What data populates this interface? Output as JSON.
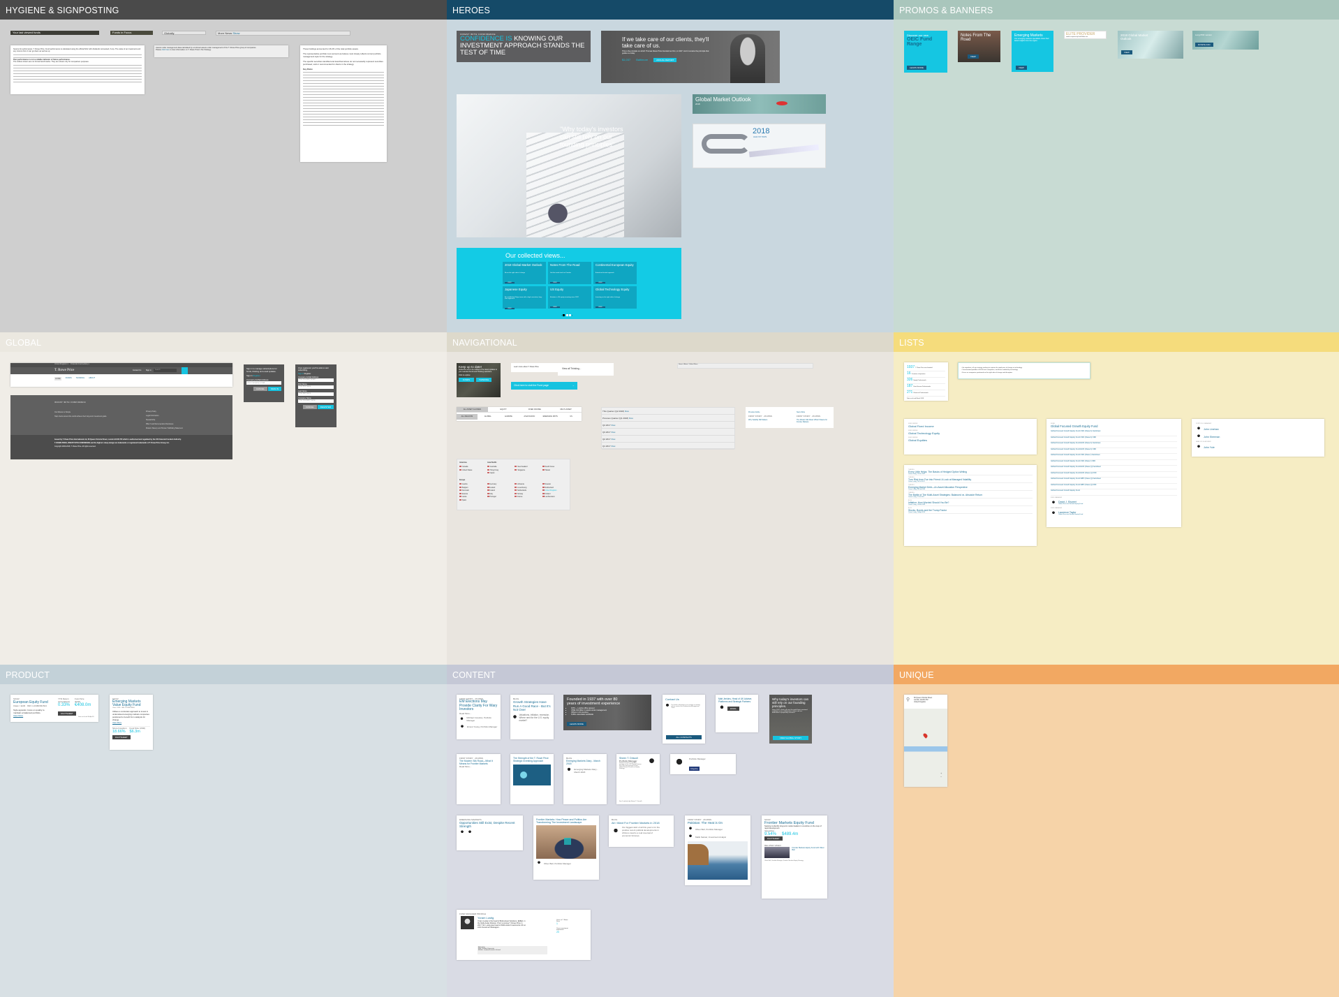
{
  "sections": {
    "hygiene": "HYGIENE & SIGNPOSTING",
    "heroes": "HEROES",
    "promos": "PROMOS & BANNERS",
    "global": "GLOBAL",
    "navigational": "NAVIGATIONAL",
    "lists": "LISTS",
    "product": "PRODUCT",
    "content": "CONTENT",
    "unique": "UNIQUE"
  },
  "colors": {
    "accent": "#16c3e0",
    "link": "#1a6e95",
    "navy": "#1b5a7e"
  },
  "hygiene": {
    "bars": [
      "Your last viewed funds",
      "Funds in Focus",
      "Globally",
      "More News"
    ],
    "show": "Show",
    "doc1": {
      "p1": "Source for performance: T. Rowe Price. Fund performance is calculated using the official NAV with dividends reinvested, if any. The value of an investment and any income from it can go down as well as up.",
      "bold": "Past performance is not a reliable indicator of future performance.",
      "p2": "The indices shown are not formal benchmarks. They are shown only for comparison purposes."
    },
    "doc2": {
      "p1": "Assets under management data calculated by combined assets under management of the T. Rowe Price group of companies.",
      "p2a": "Please ",
      "link": "click here",
      "p2b": " to view information on T. Rowe Price's Tax Strategy."
    },
    "doc3": {
      "p1": "These holdings accounted for 26.2% of the total portfolio assets.",
      "p2": "The representative portfolio is an account we believe most closely reflects current portfolio management style for the strategy.",
      "p3": "The specific securities identified and described above do not necessarily represent securities purchased, sold or recommended for clients in the strategy.",
      "risk": "Key Risks:"
    }
  },
  "heroes": {
    "confidence": {
      "eyebrow": "INVEST WITH CONFIDENCE",
      "hl": "CONFIDENCE IS",
      "rest": " KNOWING OUR INVESTMENT APPROACH STANDS THE TEST OF TIME"
    },
    "quote": {
      "text": "If we take care of our clients, they'll take care of us.",
      "sub": "This is the principle on which Thomas Rowe Price founded our firm, in 1937. And it remains the principle that guides us today.",
      "s1": "$1,037",
      "s2": "Baltimore",
      "button": "ANNUAL REPORT"
    },
    "stairs": "\"Why today's investors can still rely on our founding principles\"",
    "gmo": {
      "title": "Global Market Outlook",
      "year": "2018"
    },
    "trip": {
      "year": "2018",
      "sub": "ANALYST TRIPS"
    },
    "collected": {
      "title": "Our collected views...",
      "view": "VIEW",
      "items": [
        {
          "t": "2018 Global Market Outlook",
          "d": "Be on the right side of change"
        },
        {
          "t": "Notes From The Road",
          "d": "Get the inside track on Frontier"
        },
        {
          "t": "Continental European Equity",
          "d": "A tried and tested approach"
        },
        {
          "t": "Japanese Equity",
          "d": "An established Tokyo team with a high conviction, long-term approach"
        },
        {
          "t": "US Equity",
          "d": "A leader in US equity investing since 1937"
        },
        {
          "t": "Global Technology Equity",
          "d": "Investing on the right side of change"
        }
      ]
    }
  },
  "promos": {
    "oeic": {
      "pre": "Discover our new",
      "title": "OEIC Fund Range",
      "button": "LEARN MORE"
    },
    "notes": {
      "title": "Notes From The Road",
      "button": "VIEW"
    },
    "em": {
      "title": "Emerging Markets",
      "desc": "Our emerging markets specialists share their latest insights from the region.",
      "button": "VIEW"
    },
    "elite": {
      "title": "ELITE PROVIDER",
      "sub": "rated for expertise by FundCalibre.com"
    },
    "gmo": {
      "title": "2018 Global Market Outlook",
      "button": "VIEW"
    },
    "pdf": {
      "title": "Long PDF version",
      "button": "DOWNLOAD"
    }
  },
  "global": {
    "topbar": {
      "country": "United Kingdom",
      "role": "Financial Intermediary",
      "logo": "T. Rowe Price",
      "contact": "Contact Us",
      "signin": "Sign in",
      "search": "Search"
    },
    "nav": [
      "HOME",
      "FUNDS",
      "THINKING",
      "ABOUT"
    ],
    "footer": {
      "tag": "INVEST WITH CONFIDENCE",
      "mission_h": "Our Mission is Simple",
      "mission": "Help clients around the world achieve their long-term investment goals.",
      "links": [
        "Privacy Policy",
        "Legal Information",
        "Stewardship",
        "Pillar 3 and Remuneration Disclosure",
        "Modern Slavery and Human Trafficking Statement"
      ],
      "issued": "Issued by T. Rowe Price International Ltd, 60 Queen Victoria Street, London EC4N 4TZ which is authorised and regulated by the UK Financial Conduct Authority.",
      "tm": "T. ROWE PRICE, INVEST WITH CONFIDENCE and the bighorn sheep design are trademarks or registered trademarks of T. Rowe Price Group, Inc.",
      "copy": "Copyright 2000-2018, T. Rowe Price. All rights reserved."
    },
    "signin": {
      "text": "Sign in to manage subscriptions for funds, thinking and email updates.",
      "tabs": [
        "Sign in",
        "Register"
      ],
      "label": "Company E-Mail Address",
      "ph": "Your company email",
      "cancel": "CANCEL",
      "submit": "SIGN IN"
    },
    "register": {
      "text": "Once registered, you'll be able to start subscribing.",
      "tabs": [
        "Sign in",
        "Register"
      ],
      "fields": [
        {
          "l": "Company E-Mail Address",
          "p": "Your company email"
        },
        {
          "l": "First Name",
          "p": "Your first name"
        },
        {
          "l": "Last Name",
          "p": "Your last name"
        },
        {
          "l": "Company Name",
          "p": "Your company name"
        }
      ],
      "cancel": "CANCEL",
      "submit": "REGISTER"
    }
  },
  "nav": {
    "keep": {
      "title": "Keep up to date!",
      "text": "Subscribe now to be notified of the latest updates to your selected Funds and Thinking selections.",
      "cta": "Click to explore:",
      "b1": "FUNDS",
      "b2": "THINKING"
    },
    "learn": "Learn more about T. Rowe Price",
    "fundbtn": "Click here to visit the Fund page",
    "viewall": "View all Thinking...",
    "breadcrumb": "Home / About / Global Menu",
    "assets": [
      "ALL ASSET CLASSES",
      "EQUITY",
      "FIXED INCOME",
      "MULTI-ASSET"
    ],
    "regions": [
      "ALL REGIONS",
      "GLOBAL",
      "EUROPE",
      "ASIA PACIFIC",
      "EMERGING MKTS",
      "US"
    ],
    "quarters": [
      "This Quarter (Q2 2018)",
      "Previous Quarter (Q1 2018)",
      "Q4 2017",
      "Q3 2017",
      "Q2 2017",
      "Q1 2017"
    ],
    "show": "Show",
    "prevnext": {
      "prev": "Previous Article",
      "next": "Next Article",
      "meta": "FIRST STORY · 26 MINS",
      "prev_t": "Why Volatility Still Matters",
      "next_t": "The Modern Silk Road: What It Means for Frontier Markets"
    },
    "countries": {
      "americas": "Americas",
      "apac": "Asia Pacific",
      "europe": "Europe",
      "am": [
        "Canada",
        "United States"
      ],
      "ap": [
        "Australia",
        "New Zealand",
        "South Korea",
        "Hong Kong",
        "Singapore",
        "Taiwan",
        "Japan"
      ],
      "eu": [
        "Austria",
        "Germany",
        "Lithuania",
        "Sweden",
        "Belgium",
        "Iceland",
        "Luxembourg",
        "Switzerland",
        "Denmark",
        "Ireland",
        "Netherlands",
        "United Kingdom",
        "Estonia",
        "Italy",
        "Norway",
        "Finland",
        "Latvia",
        "Portugal",
        "France",
        "Liechtenstein",
        "Spain"
      ]
    }
  },
  "lists": {
    "stats": [
      {
        "n": "1937",
        "l": "T. Rowe Price was founded"
      },
      {
        "n": "16",
        "l": "Countries of operation"
      },
      {
        "n": "326",
        "l": "Equity Professionals"
      },
      {
        "n": "187",
        "l": "Fixed Income Professionals"
      },
      {
        "n": "271",
        "l": "Research Professionals"
      }
    ],
    "stats_note": "Data as of end March 2018",
    "bullets": [
      "Go anywhere, all cap strategy seeking to capture the rapid pace of change in technology.",
      "Concentrated portfolio of 40-60 tech companies, and those enabled by technology.",
      "Focus on companies positioned on the right side of change and disruption."
    ],
    "funds": {
      "label": "FUND SERIES",
      "items": [
        "Global Fixed Income",
        "Global Technology Equity",
        "Global Equities"
      ]
    },
    "docs": {
      "label": "SICAV",
      "title": "Global Focused Growth Equity Fund",
      "items": [
        "Global Focused Growth Equity Fund USD (Class A) Factsheet",
        "Global Focused Growth Equity Fund USD (Class A) KIID",
        "Global Focused Growth Equity Fund EUR (Class A) Factsheet",
        "Global Focused Growth Equity Fund EUR (Class A) KIID",
        "Global Focused Growth Equity Fund USD (Class I) Factsheet",
        "Global Focused Growth Equity Fund USD (Class I) KIID",
        "Global Focused Growth Equity Fund EUR (Class Q) Factsheet",
        "Global Focused Growth Equity Fund EUR (Class Q) KIID",
        "Global Focused Growth Equity Fund GBP (Class Q) Factsheet",
        "Global Focused Growth Equity Fund GBP (Class Q) KIID",
        "Global Focused Growth Equity Fund"
      ],
      "mlabel": "FUND MANAGER",
      "managers": [
        "David J. Eiswert",
        "Laurence Taylor"
      ],
      "mfund": "Global Focused Growth Equity Fund"
    },
    "people": {
      "l1": "PORTFOLIO MANAGER",
      "l2": "HEAD OF UK ADVISER",
      "names": [
        "John Linehan",
        "John Sherman",
        "John Yule"
      ]
    },
    "thinking": [
      {
        "k": "THINKING",
        "t": "Every Little Helps: The Basics of Hedged Option Writing",
        "m": "Yoram Lustig, 21-Dec-2017"
      },
      {
        "k": "THINKING",
        "t": "Turn Risk from Foe into Friend: A Look at Managed Volatility",
        "m": "Yoram Lustig, 24-Oct-2017"
      },
      {
        "k": "THINKING",
        "t": "Emerging Market Debt—An Asset Allocation Perspective",
        "m": "Yoram Lustig, 06-Feb-2018"
      },
      {
        "k": "THINKING",
        "t": "The Battle of The Multi-Asset Strategies: Balanced vs. Absolute Return",
        "m": "Yoram Lustig, 27-Jul-2017"
      },
      {
        "k": "BLOG",
        "t": "Inflation: How Worried Should You Be?",
        "m": "Yoram Lustig, 15-Mar-2018"
      },
      {
        "k": "BLOG",
        "t": "Stocks, Bonds and the Trump Factor",
        "m": "Yoram Lustig, 16-Apr-2018"
      }
    ]
  },
  "product": {
    "eu": {
      "k": "SICAV",
      "title": "European Equity Fund",
      "meta": "Class: I EUR · ISIN: LU0382931524",
      "desc": "Style agnostic, focus on quality to maintain a balanced portfolio.",
      "more": "View More",
      "l1": "YTD Return (Annualised)",
      "l2": "Fund Size (EUR)",
      "v1": "0.33%",
      "v2": "€408.0m",
      "button": "FACTSHEET",
      "note": "Data as of end 30-Apr-18"
    },
    "em": {
      "k": "SICAV",
      "title": "Emerging Markets Value Equity Fund",
      "meta": "Class: I USD · ISIN: LU1244138090",
      "desc": "Utilises a contrarian approach to invest in undervalued emerging markets companies positioned to benefit from catalysts for change.",
      "more": "View More",
      "l1": "Since Inception",
      "l2": "Fund Size (USD)",
      "v1": "18.66%",
      "v2": "$6.3m",
      "button": "FACTSHEET",
      "note": "Data as of end 30-Apr-18"
    }
  },
  "content": {
    "readmore": "Read More...",
    "em": {
      "k": "FIRST STORY · 26 MINS",
      "t": "EM Elections May Provide Clarity For Wary Investors",
      "p1": "Michael Conelius, Portfolio Manager",
      "p2": "Ernest Yeung, Portfolio Manager"
    },
    "growth": {
      "k": "BLOG",
      "t": "Growth Strategies Have Run A Good Race - But It's Not Over",
      "d": "Valuations, inflation, recession. Where next for the U.S. equity market?"
    },
    "founded": {
      "t": "Founded in 1937 with over 80 years of investment experience",
      "b": [
        "1979 — London office opened",
        "US$1,011 billion in assets under management",
        "Offices in 16 countries",
        "6,800+ associates worldwide"
      ],
      "button": "LEARN MORE"
    },
    "contact": {
      "t": "Contact Us",
      "d": "For further information or to arrange a meeting please contact the Relationship Management Team.",
      "button": "ALL CONTACTS"
    },
    "matt": {
      "t": "Matt Jenkins, Head of UK Adviser, Platforms and Strategic Partners",
      "button": "EMAIL"
    },
    "why": {
      "t": "Why today's investors can still rely on our founding principles.",
      "d": "Since 1937, clients all over the world have remained confident in our collaborative culture and our dedication to proprietary research.",
      "button": "VIEW GLOBAL STORY"
    },
    "silk": {
      "k": "FIRST STORY · 26 MINS",
      "t": "The Modern Silk Road—What It Means for Frontier Markets"
    },
    "strength": {
      "t": "The Strength of the T. Rowe Price Strategic Investing Approach"
    },
    "diary": {
      "k": "BLOG",
      "t": "Emerging Markets Diary - March 2018",
      "d": "Emerging Markets Diary - March 2018"
    },
    "sheen": {
      "t": "Sheen T. Driscoll",
      "r": "Portfolio Manager",
      "d": "Shawn Driscoll is a portfolio manager in the U.S. Equity Division. He is the lead manager for the Global Natural Resources Equity Strategy.",
      "link": "See 5 article(s) by Shawn T. Driscoll..."
    },
    "citywire": {
      "n": "Citywire",
      "l": "Portfolio Manager"
    },
    "opps": {
      "k": "EMERGING MARKETS",
      "t": "Opportunities Still Exist, Despite Recent Strength"
    },
    "frontier": {
      "t": "Frontier Markets: How Peace and Politics Are Transforming The Investment Landscape",
      "m": "Oliver Bell, Portfolio Manager"
    },
    "allwant": {
      "k": "BLOG",
      "t": "All I Want For Frontier Markets in 2018",
      "d": "Our biggest wish of all this year is for the positive recent political developments in Africa to lead to a real reversal of economic fortunes."
    },
    "pakistan": {
      "k": "FIRST STORY · 26 MINS",
      "t": "Pakistan: The Heat is On",
      "p1": "Oliver Bell, Portfolio Manager",
      "p2": "Malik Sarwar, Investment Analyst"
    },
    "fmef": {
      "k": "SICAV",
      "t": "Frontier Markets Equity Fund",
      "d": "Seeking to identify long-term market leaders in countries on the cusp of rapid development.",
      "more": "View More",
      "v1": "9.54%",
      "v2": "$489.4m",
      "button": "FACTSHEET",
      "related": "RELATED VIDEO",
      "rt": "Frontier Markets Equity Fund with Oliver Bell",
      "m": "Oliver Bell, Portfolio Manager, Frontier Markets Equity Strategy"
    },
    "profile": {
      "k": "FUND MANAGER PROFILE",
      "name": "Yoram Lustig",
      "bio": "Yoram Lustig is the head of Multi-Asset Solutions, EMEA, in the Multi-Asset Division. Prior to joining T. Rowe Price in 2017, Mr. Lustig was head of Multi-Asset Investments UK at AXA Investment Managers.",
      "edu": [
        "Education",
        "B.A., Tel Aviv University",
        "M.B.A., London Business School"
      ],
      "y1l": "Years at T. Rowe Price",
      "y1": "1",
      "y2l": "Years investment experience",
      "y2": "20"
    }
  },
  "unique": {
    "address": [
      "60 Queen Victoria Street",
      "London, EC4N 4TZ",
      "United Kingdom"
    ]
  }
}
